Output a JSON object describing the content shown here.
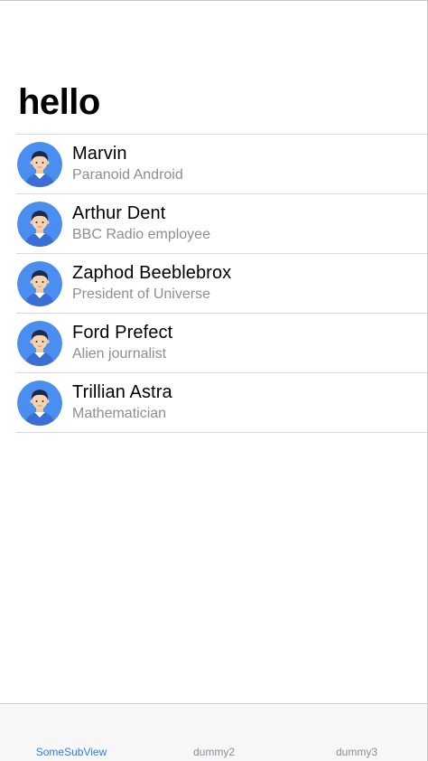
{
  "nav": {
    "title": "hello"
  },
  "people": [
    {
      "name": "Marvin",
      "subtitle": "Paranoid Android",
      "avatar_icon": "person-avatar-icon"
    },
    {
      "name": "Arthur Dent",
      "subtitle": "BBC Radio employee",
      "avatar_icon": "person-avatar-icon"
    },
    {
      "name": "Zaphod Beeblebrox",
      "subtitle": "President of Universe",
      "avatar_icon": "person-avatar-icon"
    },
    {
      "name": "Ford Prefect",
      "subtitle": "Alien journalist",
      "avatar_icon": "person-avatar-icon"
    },
    {
      "name": "Trillian Astra",
      "subtitle": "Mathematician",
      "avatar_icon": "person-avatar-icon"
    }
  ],
  "tabbar": {
    "tabs": [
      {
        "label": "SomeSubView",
        "selected": true
      },
      {
        "label": "dummy2",
        "selected": false
      },
      {
        "label": "dummy3",
        "selected": false
      }
    ]
  },
  "colors": {
    "accent": "#2f7cf6",
    "avatar_background": "#4a8ff0",
    "separator": "#d9d9dc",
    "subtitle": "#8e8e93"
  }
}
